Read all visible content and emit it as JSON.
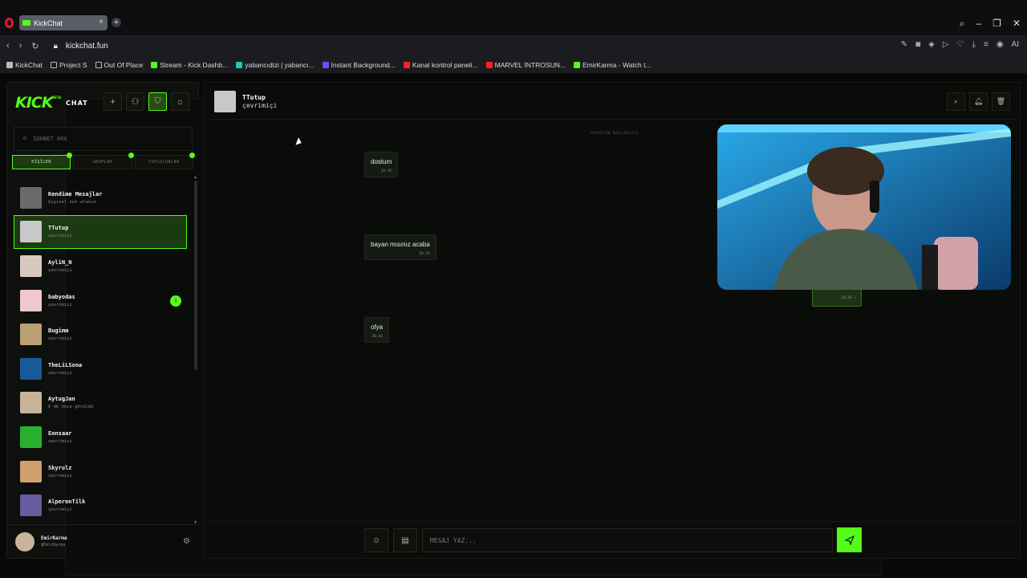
{
  "browser": {
    "tab_title": "KickChat",
    "url": "kickchat.fun",
    "bookmarks": [
      {
        "label": "KickChat",
        "color": "#bbbbbb"
      },
      {
        "label": "Project S",
        "color": "#bbbbbb"
      },
      {
        "label": "Out Of Place",
        "color": "#bbbbbb"
      },
      {
        "label": "Stream - Kick Dashb...",
        "color": "#53fc18"
      },
      {
        "label": "yabancıdizi | yabancı...",
        "color": "#1ec8b0"
      },
      {
        "label": "Instant Background...",
        "color": "#6b4cff"
      },
      {
        "label": "Kanal kontrol paneli...",
        "color": "#ff2020"
      },
      {
        "label": "MARVEL İNTROSUN...",
        "color": "#ff2020"
      },
      {
        "label": "EmirKarma - Watch t...",
        "color": "#53fc18"
      }
    ],
    "ai_label": "AI"
  },
  "brand": {
    "kick": "KICK",
    "beta": "BETA",
    "chat": "CHAT"
  },
  "sidebar": {
    "search_placeholder": "SOHBET ARA",
    "tabs": [
      "KİŞİLER",
      "GRUPLAR",
      "TOPLULUKLAR"
    ],
    "contacts": [
      {
        "name": "Kendime Mesajlar",
        "status": "kişisel not alanın",
        "color": "#6a6a6a"
      },
      {
        "name": "TTutup",
        "status": "çevrimiçi",
        "color": "#c8c8c8"
      },
      {
        "name": "AyliN_N",
        "status": "çevrimiçi",
        "color": "#d8c8c0"
      },
      {
        "name": "babyodas",
        "status": "çevrimiçi",
        "color": "#f0c8d0",
        "unread": "1"
      },
      {
        "name": "Bugimm",
        "status": "çevrimiçi",
        "color": "#b8a070"
      },
      {
        "name": "TheLiLSona",
        "status": "çevrimiçi",
        "color": "#1a5a9a"
      },
      {
        "name": "AytugJan",
        "status": "6 dk önce görüldü",
        "color": "#c8b49a"
      },
      {
        "name": "Eonsaar",
        "status": "çevrimiçi",
        "color": "#2ab030"
      },
      {
        "name": "Skyrulz",
        "status": "çevrimiçi",
        "color": "#d0a070"
      },
      {
        "name": "AlperenTilk",
        "status": "çevrimiçi",
        "color": "#6a5aa0"
      }
    ],
    "me": {
      "name": "EmirKarma",
      "handle": "@EmirKarma"
    }
  },
  "chat": {
    "title": "TTutup",
    "subtitle": "çevrimiçi",
    "start_label": "SOHBETIN BAŞLANGICI",
    "messages": [
      {
        "text": "dostum",
        "time": "20:35"
      },
      {
        "text": "bayan mısınız acaba",
        "time": "20:36"
      },
      {
        "text": "ofya",
        "time": "20:36"
      }
    ],
    "out_time": "20:36 ✓",
    "input_placeholder": "MESAJ YAZ..."
  },
  "colors": {
    "accent": "#53fc18"
  }
}
